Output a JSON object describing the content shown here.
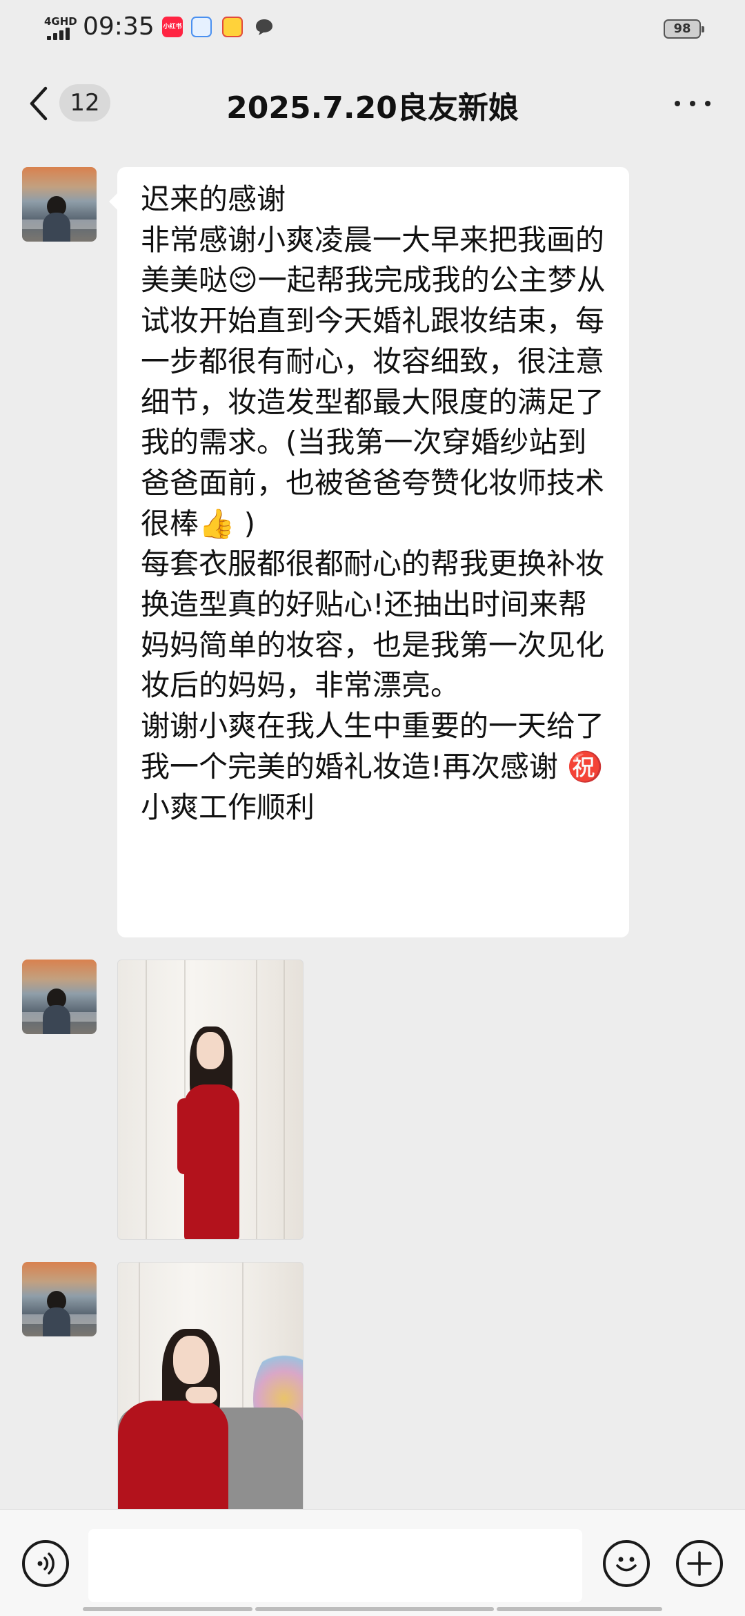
{
  "status_bar": {
    "network": "4GHD",
    "time": "09:35",
    "apps": [
      {
        "name": "小红书",
        "icon": "xiaohongshu-icon"
      },
      {
        "name": "",
        "icon": "blue-app-icon"
      },
      {
        "name": "",
        "icon": "game-app-icon"
      },
      {
        "name": "",
        "icon": "chat-bubble-icon"
      }
    ],
    "battery": "98"
  },
  "header": {
    "back_icon": "chevron-left-icon",
    "unread_count": "12",
    "title": "2025.7.20良友新娘",
    "more_icon": "more-dots-icon"
  },
  "messages": [
    {
      "type": "text",
      "text": "迟来的感谢\n非常感谢小爽凌晨一大早来把我画的美美哒😌一起帮我完成我的公主梦从试妆开始直到今天婚礼跟妆结束，每一步都很有耐心，妆容细致，很注意细节，妆造发型都最大限度的满足了我的需求。(当我第一次穿婚纱站到爸爸面前，也被爸爸夸赞化妆师技术很棒👍 )\n每套衣服都很都耐心的帮我更换补妆换造型真的好贴心!还抽出时间来帮妈妈简单的妆容，也是我第一次见化妆后的妈妈，非常漂亮。\n谢谢小爽在我人生中重要的一天给了我一个完美的婚礼妆造!再次感谢 ㊗️小爽工作顺利"
    },
    {
      "type": "image",
      "description_icon": "photo-red-dress-standing"
    },
    {
      "type": "image",
      "description_icon": "photo-red-dress-sofa"
    }
  ],
  "input_bar": {
    "voice_icon": "voice-icon",
    "placeholder": "",
    "emoji_icon": "emoji-icon",
    "plus_icon": "plus-icon"
  },
  "colors": {
    "background": "#ededed",
    "bubble": "#ffffff",
    "text": "#111111",
    "dress_red": "#b3121c"
  }
}
